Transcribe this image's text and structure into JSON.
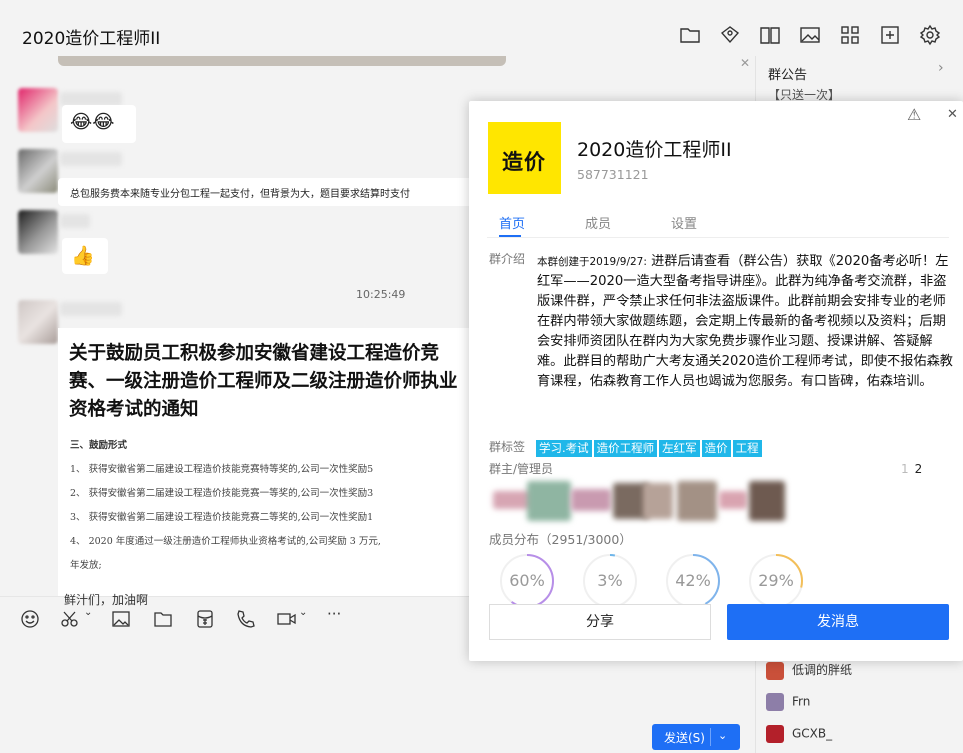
{
  "window": {
    "title": "2020造价工程师II",
    "controls": [
      "—",
      "☐",
      "✕"
    ]
  },
  "header": {
    "icons": [
      "folder-icon",
      "album-icon",
      "book-icon",
      "image-icon",
      "apps-icon",
      "add-app-icon",
      "settings-icon"
    ]
  },
  "chat": {
    "message_text": "总包服务费本来随专业分包工程一起支付，但背景为大，题目要求结算时支付",
    "timestamp": "10:25:49",
    "close_glyph": "✕",
    "document": {
      "title": "关于鼓励员工积极参加安徽省建设工程造价竞赛、一级注册造价工程师及二级注册造价师执业资格考试的通知",
      "lines": [
        "三、鼓励形式",
        "1、 获得安徽省第二届建设工程造价技能竞赛特等奖的,公司一次性奖励5",
        "2、 获得安徽省第二届建设工程造价技能竞赛一等奖的,公司一次性奖励3",
        "3、 获得安徽省第二届建设工程造价技能竞赛二等奖的,公司一次性奖励1",
        "4、 2020 年度通过一级注册造价工程师执业资格考试的,公司奖励 3 万元,",
        "   年发放;"
      ]
    },
    "partial_caption": "鲜汁们，加油啊"
  },
  "toolbar": {
    "more": "···",
    "send_label": "发送(S)",
    "send_chevron": "⌄"
  },
  "right_panel": {
    "notice_title": "群公告",
    "notice_arrow": "›",
    "notice_sub": "【只送一次】",
    "members": [
      {
        "name": "低调的胖纸",
        "color": "#c9503a"
      },
      {
        "name": "Frn",
        "color": "#8d7ea8"
      },
      {
        "name": "GCXB_",
        "color": "#b3202a"
      }
    ]
  },
  "card": {
    "warn_glyph": "⚠",
    "close_glyph": "✕",
    "logo_text": "造价",
    "group_name": "2020造价工程师II",
    "group_id": "587731121",
    "tabs": [
      "首页",
      "成员",
      "设置"
    ],
    "intro_label": "群介绍",
    "intro_small": "本群创建于2019/9/27:",
    "intro_text": " 进群后请查看（群公告）获取《2020备考必听！左红军——2020一造大型备考指导讲座》。此群为纯净备考交流群，非盗版课件群，严令禁止求任何非法盗版课件。此群前期会安排专业的老师在群内带领大家做题练题，会定期上传最新的备考视频以及资料；后期会安排师资团队在群内为大家免费步骤作业习题、授课讲解、答疑解难。此群目的帮助广大考友通关2020造价工程师考试，即使不报佑森教育课程，佑森教育工作人员也竭诚为您服务。有口皆碑，佑森培训。",
    "tags_label": "群标签",
    "tags": [
      "学习.考试",
      "造价工程师",
      "左红军",
      "造价",
      "工程"
    ],
    "admins_label": "群主/管理员",
    "pager": {
      "current": "1",
      "total": "2"
    },
    "dist_label": "成员分布（2951/3000）",
    "rings": [
      {
        "text": "60%",
        "value": 0.6,
        "color": "#b78ee8"
      },
      {
        "text": "3%",
        "value": 0.03,
        "color": "#6fb6ea"
      },
      {
        "text": "42%",
        "value": 0.42,
        "color": "#7fb4ec"
      },
      {
        "text": "29%",
        "value": 0.29,
        "color": "#f3bf59"
      }
    ],
    "share_button": "分享",
    "message_button": "发消息"
  }
}
